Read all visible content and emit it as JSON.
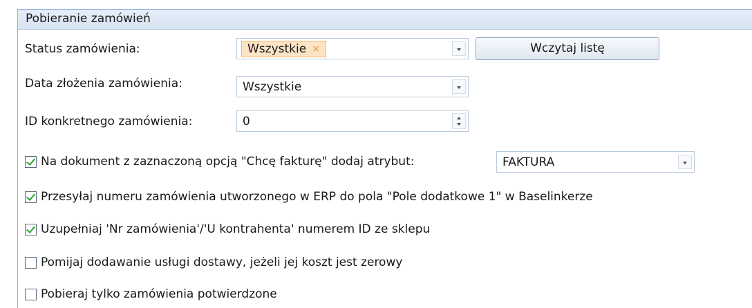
{
  "section": {
    "title": "Pobieranie zamówień"
  },
  "status": {
    "label": "Status zamówienia:",
    "chip": "Wszystkie",
    "chip_remove": "×",
    "load_button": "Wczytaj listę"
  },
  "date": {
    "label": "Data złożenia zamówienia:",
    "value": "Wszystkie"
  },
  "order_id": {
    "label": "ID konkretnego zamówienia:",
    "value": "0"
  },
  "invoice_option": {
    "label": "Na dokument z zaznaczoną opcją \"Chcę fakturę\" dodaj atrybut:",
    "checked": true,
    "attribute_value": "FAKTURA"
  },
  "options": [
    {
      "label": "Przesyłaj numeru zamówienia utworzonego w ERP do pola \"Pole dodatkowe 1\" w Baselinkerze",
      "checked": true
    },
    {
      "label": "Uzupełniaj 'Nr zamówienia'/'U kontrahenta' numerem ID ze sklepu",
      "checked": true
    },
    {
      "label": "Pomijaj dodawanie usługi dostawy, jeżeli jej koszt jest zerowy",
      "checked": false
    },
    {
      "label": "Pobieraj tylko zamówienia potwierdzone",
      "checked": false
    }
  ]
}
